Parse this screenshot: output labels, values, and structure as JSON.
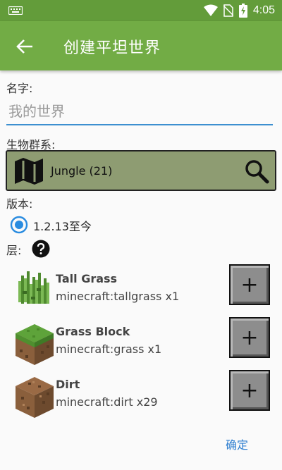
{
  "status_bar": {
    "time": "4:05"
  },
  "app_bar": {
    "title": "创建平坦世界"
  },
  "name_field": {
    "label": "名字:",
    "placeholder": "我的世界",
    "value": ""
  },
  "biome": {
    "label": "生物群系:",
    "selected": "Jungle (21)"
  },
  "version": {
    "label": "版本:",
    "option": "1.2.13至今",
    "selected": true
  },
  "layers": {
    "label": "层:",
    "items": [
      {
        "name": "Tall Grass",
        "id": "minecraft:tallgrass x1",
        "block_icon": "tall-grass-block-icon",
        "add_label": "+"
      },
      {
        "name": "Grass Block",
        "id": "minecraft:grass x1",
        "block_icon": "grass-block-icon",
        "add_label": "+"
      },
      {
        "name": "Dirt",
        "id": "minecraft:dirt x29",
        "block_icon": "dirt-block-icon",
        "add_label": "+"
      }
    ]
  },
  "confirm_label": "确定",
  "colors": {
    "status_bar": "#639c3a",
    "app_bar": "#72ac45",
    "biome_box": "#8e9c72",
    "accent": "#3d8fd0"
  }
}
